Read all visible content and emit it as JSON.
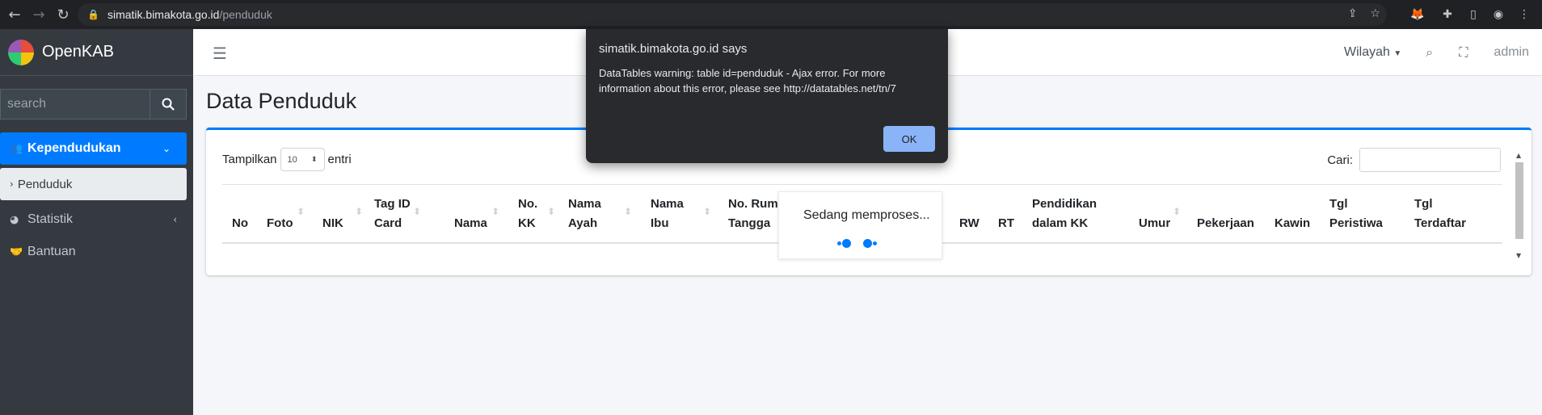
{
  "browser": {
    "url_host": "simatik.bimakota.go.id",
    "url_path": "/penduduk"
  },
  "sidebar": {
    "brand": "OpenKAB",
    "search_placeholder": "search",
    "items": [
      {
        "label": "Kependudukan",
        "icon": "users-icon",
        "active": true
      },
      {
        "label": "Penduduk",
        "icon": "chevron-right-icon",
        "sub": true
      },
      {
        "label": "Statistik",
        "icon": "pie-chart-icon"
      },
      {
        "label": "Bantuan",
        "icon": "handshake-icon"
      }
    ]
  },
  "navbar": {
    "wilayah_label": "Wilayah",
    "user_label": "admin"
  },
  "content": {
    "title": "Data Penduduk",
    "length_prefix": "Tampilkan",
    "length_value": "10",
    "length_suffix": "entri",
    "filter_label": "Cari:",
    "processing_text": "Sedang memproses...",
    "columns": [
      "No",
      "Foto",
      "NIK",
      "Tag ID\nCard",
      "Nama",
      "No.\nKK",
      "Nama\nAyah",
      "Nama\nIbu",
      "No. Rumah\nTangga",
      "RW",
      "RT",
      "Pendidikan\ndalam KK",
      "Umur",
      "Pekerjaan",
      "Kawin",
      "Tgl\nPeristiwa",
      "Tgl\nTerdaftar"
    ]
  },
  "dialog": {
    "title": "simatik.bimakota.go.id says",
    "message": "DataTables warning: table id=penduduk - Ajax error. For more information about this error, please see http://datatables.net/tn/7",
    "ok_label": "OK"
  },
  "colors": {
    "primary": "#007bff",
    "sidebar_bg": "#343a40",
    "dialog_bg": "#292a2d",
    "dialog_button": "#8ab4f8"
  }
}
